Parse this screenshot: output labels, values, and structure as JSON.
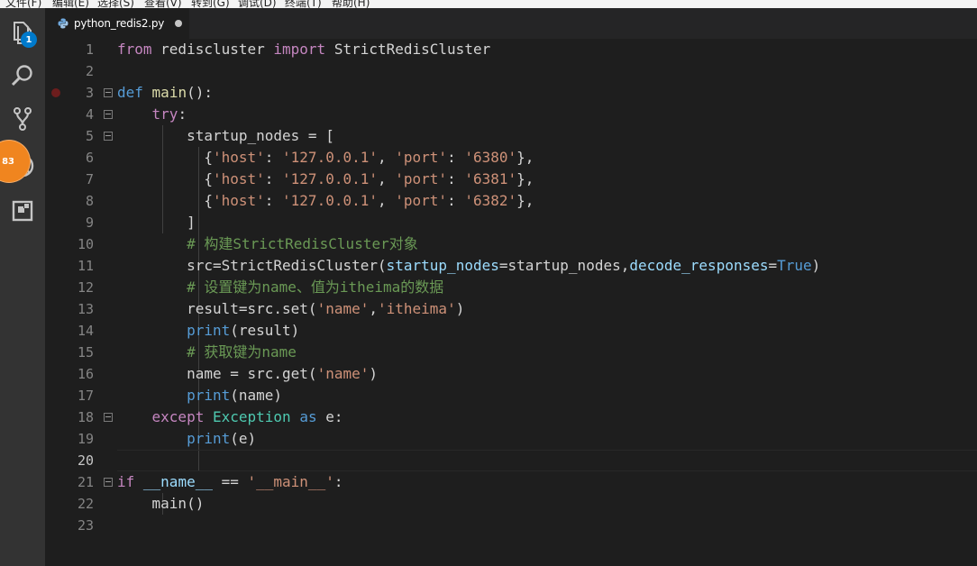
{
  "menubar": {
    "items": [
      "文件(F)",
      "编辑(E)",
      "选择(S)",
      "查看(V)",
      "转到(G)",
      "调试(D)",
      "终端(T)",
      "帮助(H)"
    ]
  },
  "activity_bar": {
    "explorer_badge": "1",
    "debug_badge": "83",
    "icons": [
      "files-icon",
      "search-icon",
      "source-control-icon",
      "debug-icon",
      "extensions-icon"
    ]
  },
  "tab": {
    "filename": "python_redis2.py",
    "unsaved": true
  },
  "editor": {
    "active_line": 20,
    "breakpoint_line": 3,
    "lines": [
      {
        "n": "1",
        "tokens": [
          [
            "ctl",
            "from"
          ],
          [
            "plain",
            " rediscluster "
          ],
          [
            "ctl",
            "import"
          ],
          [
            "plain",
            " StrictRedisCluster"
          ]
        ]
      },
      {
        "n": "2",
        "tokens": []
      },
      {
        "n": "3",
        "tokens": [
          [
            "kw",
            "def"
          ],
          [
            "plain",
            " "
          ],
          [
            "fn",
            "main"
          ],
          [
            "plain",
            "():"
          ]
        ]
      },
      {
        "n": "4",
        "tokens": [
          [
            "plain",
            "    "
          ],
          [
            "ctl",
            "try"
          ],
          [
            "plain",
            ":"
          ]
        ]
      },
      {
        "n": "5",
        "tokens": [
          [
            "plain",
            "        startup_nodes = ["
          ]
        ]
      },
      {
        "n": "6",
        "tokens": [
          [
            "plain",
            "          {"
          ],
          [
            "str",
            "'host'"
          ],
          [
            "plain",
            ": "
          ],
          [
            "str",
            "'127.0.0.1'"
          ],
          [
            "plain",
            ", "
          ],
          [
            "str",
            "'port'"
          ],
          [
            "plain",
            ": "
          ],
          [
            "str",
            "'6380'"
          ],
          [
            "plain",
            "},"
          ]
        ]
      },
      {
        "n": "7",
        "tokens": [
          [
            "plain",
            "          {"
          ],
          [
            "str",
            "'host'"
          ],
          [
            "plain",
            ": "
          ],
          [
            "str",
            "'127.0.0.1'"
          ],
          [
            "plain",
            ", "
          ],
          [
            "str",
            "'port'"
          ],
          [
            "plain",
            ": "
          ],
          [
            "str",
            "'6381'"
          ],
          [
            "plain",
            "},"
          ]
        ]
      },
      {
        "n": "8",
        "tokens": [
          [
            "plain",
            "          {"
          ],
          [
            "str",
            "'host'"
          ],
          [
            "plain",
            ": "
          ],
          [
            "str",
            "'127.0.0.1'"
          ],
          [
            "plain",
            ", "
          ],
          [
            "str",
            "'port'"
          ],
          [
            "plain",
            ": "
          ],
          [
            "str",
            "'6382'"
          ],
          [
            "plain",
            "},"
          ]
        ]
      },
      {
        "n": "9",
        "tokens": [
          [
            "plain",
            "        ]"
          ]
        ]
      },
      {
        "n": "10",
        "tokens": [
          [
            "plain",
            "        "
          ],
          [
            "cmt",
            "# 构建StrictRedisCluster对象"
          ]
        ]
      },
      {
        "n": "11",
        "tokens": [
          [
            "plain",
            "        src=StrictRedisCluster("
          ],
          [
            "param",
            "startup_nodes"
          ],
          [
            "plain",
            "=startup_nodes,"
          ],
          [
            "param",
            "decode_responses"
          ],
          [
            "plain",
            "="
          ],
          [
            "kw",
            "True"
          ],
          [
            "plain",
            ")"
          ]
        ]
      },
      {
        "n": "12",
        "tokens": [
          [
            "plain",
            "        "
          ],
          [
            "cmt",
            "# 设置键为name、值为itheima的数据"
          ]
        ]
      },
      {
        "n": "13",
        "tokens": [
          [
            "plain",
            "        result=src.set("
          ],
          [
            "str",
            "'name'"
          ],
          [
            "plain",
            ","
          ],
          [
            "str",
            "'itheima'"
          ],
          [
            "plain",
            ")"
          ]
        ]
      },
      {
        "n": "14",
        "tokens": [
          [
            "plain",
            "        "
          ],
          [
            "kw",
            "print"
          ],
          [
            "plain",
            "(result)"
          ]
        ]
      },
      {
        "n": "15",
        "tokens": [
          [
            "plain",
            "        "
          ],
          [
            "cmt",
            "# 获取键为name"
          ]
        ]
      },
      {
        "n": "16",
        "tokens": [
          [
            "plain",
            "        name = src.get("
          ],
          [
            "str",
            "'name'"
          ],
          [
            "plain",
            ")"
          ]
        ]
      },
      {
        "n": "17",
        "tokens": [
          [
            "plain",
            "        "
          ],
          [
            "kw",
            "print"
          ],
          [
            "plain",
            "(name)"
          ]
        ]
      },
      {
        "n": "18",
        "tokens": [
          [
            "plain",
            "    "
          ],
          [
            "ctl",
            "except"
          ],
          [
            "plain",
            " "
          ],
          [
            "cls",
            "Exception"
          ],
          [
            "plain",
            " "
          ],
          [
            "kw",
            "as"
          ],
          [
            "plain",
            " e:"
          ]
        ]
      },
      {
        "n": "19",
        "tokens": [
          [
            "plain",
            "        "
          ],
          [
            "kw",
            "print"
          ],
          [
            "plain",
            "(e)"
          ]
        ]
      },
      {
        "n": "20",
        "tokens": []
      },
      {
        "n": "21",
        "tokens": [
          [
            "ctl",
            "if"
          ],
          [
            "plain",
            " "
          ],
          [
            "param",
            "__name__"
          ],
          [
            "plain",
            " == "
          ],
          [
            "str",
            "'__main__'"
          ],
          [
            "plain",
            ":"
          ]
        ]
      },
      {
        "n": "22",
        "tokens": [
          [
            "plain",
            "    main()"
          ]
        ]
      },
      {
        "n": "23",
        "tokens": []
      }
    ]
  }
}
